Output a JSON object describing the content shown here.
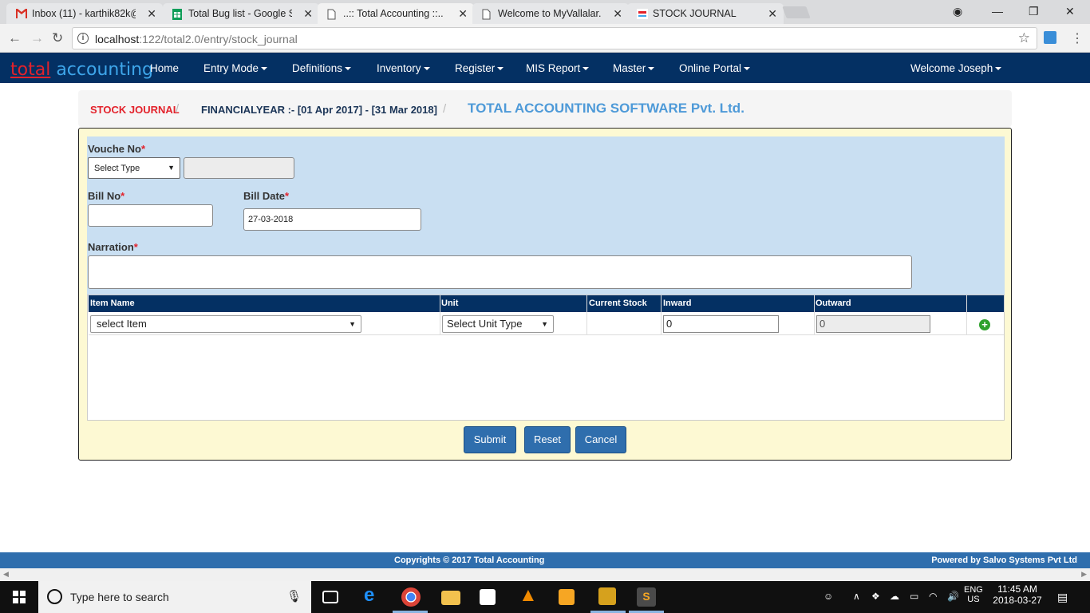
{
  "browser": {
    "tabs": [
      {
        "label": "Inbox (11) - karthik82k@",
        "icon": "gmail-icon"
      },
      {
        "label": "Total Bug list - Google Sh",
        "icon": "sheets-icon"
      },
      {
        "label": "..:: Total Accounting ::..",
        "icon": "page-icon"
      },
      {
        "label": "Welcome to MyVallalar.c",
        "icon": "page-icon"
      },
      {
        "label": "STOCK JOURNAL",
        "icon": "app-icon"
      }
    ],
    "url_host": "localhost",
    "url_path": ":122/total2.0/entry/stock_journal"
  },
  "app": {
    "brand_part1": "total",
    "brand_part2": "accounting",
    "menu": {
      "home": "Home",
      "entry_mode": "Entry Mode",
      "definitions": "Definitions",
      "inventory": "Inventory",
      "register": "Register",
      "mis_report": "MIS Report",
      "master": "Master",
      "online_portal": "Online Portal",
      "user": "Welcome Joseph"
    }
  },
  "breadcrumb": {
    "page": "STOCK JOURNAL",
    "financial_year": "FINANCIALYEAR :- [01 Apr 2017] - [31 Mar 2018]",
    "company": "TOTAL ACCOUNTING SOFTWARE Pvt. Ltd."
  },
  "form": {
    "voucher_label": "Vouche No",
    "voucher_type_selected": "Select Type",
    "voucher_no_value": "",
    "bill_no_label": "Bill No",
    "bill_no_value": "",
    "bill_date_label": "Bill Date",
    "bill_date_value": "27-03-2018",
    "narration_label": "Narration",
    "narration_value": "",
    "required_mark": "*"
  },
  "table": {
    "headers": {
      "item_name": "Item Name",
      "unit": "Unit",
      "current_stock": "Current Stock",
      "inward": "Inward",
      "outward": "Outward"
    },
    "row": {
      "item_selected": "select Item",
      "unit_selected": "Select Unit Type",
      "current_stock": "",
      "inward": "0",
      "outward": "0"
    }
  },
  "buttons": {
    "submit": "Submit",
    "reset": "Reset",
    "cancel": "Cancel"
  },
  "footer": {
    "copyright": "Copyrights © 2017 Total Accounting",
    "powered": "Powered by Salvo Systems Pvt Ltd"
  },
  "taskbar": {
    "search_placeholder": "Type here to search",
    "lang_top": "ENG",
    "lang_bottom": "US",
    "time": "11:45 AM",
    "date": "2018-03-27"
  },
  "colors": {
    "nav_bg": "#043063",
    "brand_red": "#e3222b",
    "brand_blue": "#3ea6ea",
    "button_blue": "#2f6ead",
    "panel_bg": "#fdf9d3",
    "form_bg": "#c9dff2"
  }
}
